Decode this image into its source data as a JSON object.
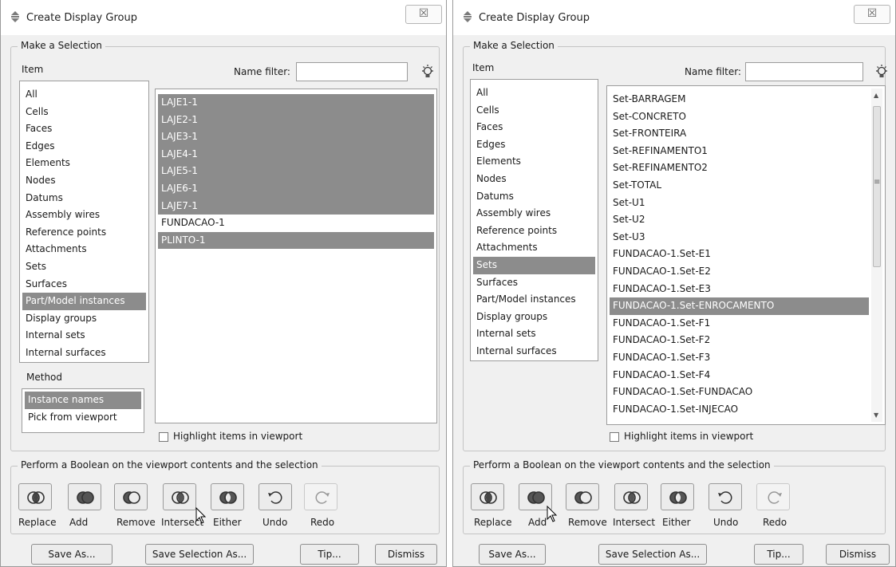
{
  "left": {
    "title": "Create Display Group",
    "close": "☒",
    "make_selection": "Make a Selection",
    "item_label": "Item",
    "name_filter_label": "Name filter:",
    "name_filter_value": "",
    "items": [
      "All",
      "Cells",
      "Faces",
      "Edges",
      "Elements",
      "Nodes",
      "Datums",
      "Assembly wires",
      "Reference points",
      "Attachments",
      "Sets",
      "Surfaces",
      "Part/Model instances",
      "Display groups",
      "Internal sets",
      "Internal surfaces"
    ],
    "selected_item": "Part/Model instances",
    "method_label": "Method",
    "methods": [
      "Instance names",
      "Pick from viewport"
    ],
    "selected_method": "Instance names",
    "names": [
      "LAJE1-1",
      "LAJE2-1",
      "LAJE3-1",
      "LAJE4-1",
      "LAJE5-1",
      "LAJE6-1",
      "LAJE7-1",
      "FUNDACAO-1",
      "PLINTO-1"
    ],
    "selected_names": [
      "LAJE1-1",
      "LAJE2-1",
      "LAJE3-1",
      "LAJE4-1",
      "LAJE5-1",
      "LAJE6-1",
      "LAJE7-1",
      "PLINTO-1"
    ],
    "highlight_label": "Highlight items in viewport",
    "boolean_label": "Perform a Boolean on the viewport contents and the selection",
    "tools": [
      "Replace",
      "Add",
      "Remove",
      "Intersect",
      "Either",
      "Undo",
      "Redo"
    ],
    "buttons": {
      "save_as": "Save As...",
      "save_selection": "Save Selection As...",
      "tip": "Tip...",
      "dismiss": "Dismiss"
    }
  },
  "right": {
    "title": "Create Display Group",
    "close": "☒",
    "make_selection": "Make a Selection",
    "item_label": "Item",
    "name_filter_label": "Name filter:",
    "name_filter_value": "",
    "items": [
      "All",
      "Cells",
      "Faces",
      "Edges",
      "Elements",
      "Nodes",
      "Datums",
      "Assembly wires",
      "Reference points",
      "Attachments",
      "Sets",
      "Surfaces",
      "Part/Model instances",
      "Display groups",
      "Internal sets",
      "Internal surfaces"
    ],
    "selected_item": "Sets",
    "names": [
      "Set-BARRAGEM",
      "Set-CONCRETO",
      "Set-FRONTEIRA",
      "Set-REFINAMENTO1",
      "Set-REFINAMENTO2",
      "Set-TOTAL",
      "Set-U1",
      "Set-U2",
      "Set-U3",
      "FUNDACAO-1.Set-E1",
      "FUNDACAO-1.Set-E2",
      "FUNDACAO-1.Set-E3",
      "FUNDACAO-1.Set-ENROCAMENTO",
      "FUNDACAO-1.Set-F1",
      "FUNDACAO-1.Set-F2",
      "FUNDACAO-1.Set-F3",
      "FUNDACAO-1.Set-F4",
      "FUNDACAO-1.Set-FUNDACAO",
      "FUNDACAO-1.Set-INJECAO"
    ],
    "selected_names": [
      "FUNDACAO-1.Set-ENROCAMENTO"
    ],
    "highlight_label": "Highlight items in viewport",
    "boolean_label": "Perform a Boolean on the viewport contents and the selection",
    "tools": [
      "Replace",
      "Add",
      "Remove",
      "Intersect",
      "Either",
      "Undo",
      "Redo"
    ],
    "buttons": {
      "save_as": "Save As...",
      "save_selection": "Save Selection As...",
      "tip": "Tip...",
      "dismiss": "Dismiss"
    }
  },
  "icons": {
    "title": "create-display-group-icon",
    "bulb": "lightbulb-icon",
    "cursor": "mouse-pointer-icon"
  },
  "colors": {
    "selection": "#8c8c8c",
    "dialog_bg": "#f0f0f0"
  }
}
